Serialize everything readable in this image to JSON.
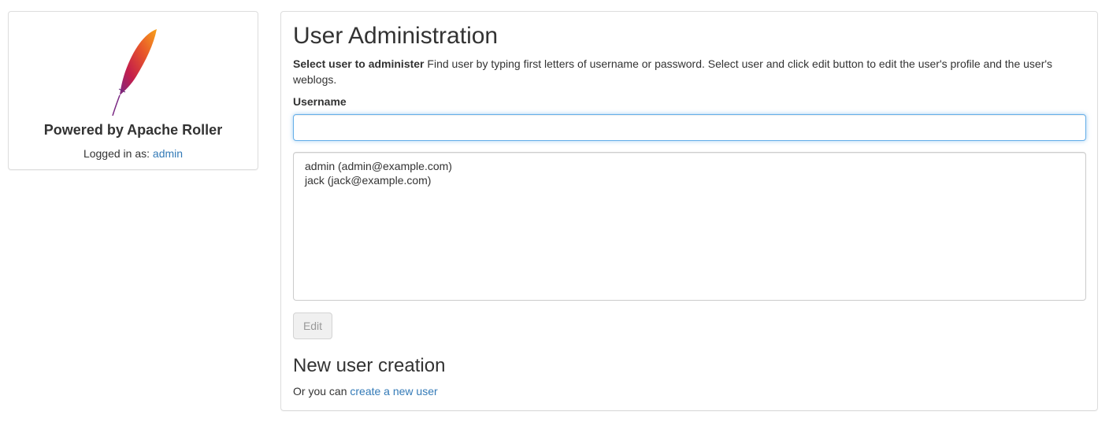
{
  "sidebar": {
    "logo_icon": "apache-feather-icon",
    "powered_by": "Powered by Apache Roller",
    "logged_in_prefix": "Logged in as: ",
    "logged_in_user": "admin"
  },
  "main": {
    "title": "User Administration",
    "description_bold": "Select user to administer",
    "description_text": " Find user by typing first letters of username or password. Select user and click edit button to edit the user's profile and the user's weblogs.",
    "username_label": "Username",
    "username_value": "",
    "users": [
      "admin (admin@example.com)",
      "jack (jack@example.com)"
    ],
    "edit_label": "Edit",
    "new_user_title": "New user creation",
    "create_prefix": "Or you can ",
    "create_link": "create a new user"
  },
  "colors": {
    "link": "#337ab7",
    "focus_border": "#66afe9"
  }
}
